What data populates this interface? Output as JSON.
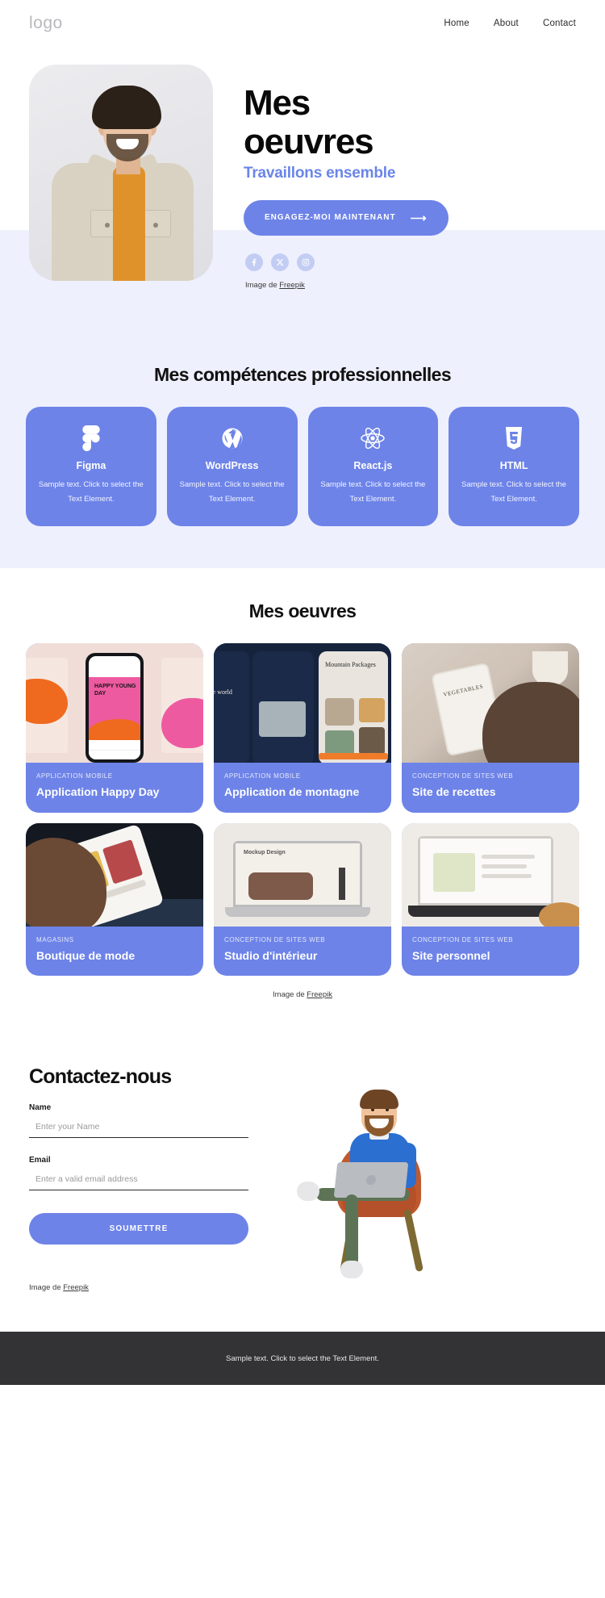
{
  "header": {
    "logo": "logo",
    "nav": [
      {
        "label": "Home"
      },
      {
        "label": "About"
      },
      {
        "label": "Contact"
      }
    ]
  },
  "hero": {
    "title_line1": "Mes",
    "title_line2": "oeuvres",
    "subtitle": "Travaillons ensemble",
    "cta_label": "ENGAGEZ-MOI MAINTENANT",
    "cta_arrow": "⟶",
    "socials": [
      {
        "name": "facebook-icon",
        "label": "Facebook"
      },
      {
        "name": "x-twitter-icon",
        "label": "X"
      },
      {
        "name": "instagram-icon",
        "label": "Instagram"
      }
    ],
    "credit_prefix": "Image de ",
    "credit_link": "Freepik",
    "photo_alt": "Homme souriant avec lunettes roses et veste beige"
  },
  "skills": {
    "title": "Mes compétences professionnelles",
    "cards": [
      {
        "icon": "figma-icon",
        "name": "Figma",
        "desc": "Sample text. Click to select the Text Element."
      },
      {
        "icon": "wordpress-icon",
        "name": "WordPress",
        "desc": "Sample text. Click to select the Text Element."
      },
      {
        "icon": "react-icon",
        "name": "React.js",
        "desc": "Sample text. Click to select the Text Element."
      },
      {
        "icon": "html5-icon",
        "name": "HTML",
        "desc": "Sample text. Click to select the Text Element."
      }
    ]
  },
  "portfolio": {
    "title": "Mes oeuvres",
    "items": [
      {
        "category": "APPLICATION MOBILE",
        "name": "Application Happy Day",
        "thumb_alt": "Maquette application Happy Young Day"
      },
      {
        "category": "APPLICATION MOBILE",
        "name": "Application de montagne",
        "thumb_alt": "Maquette application Mountain Packages"
      },
      {
        "category": "CONCEPTION DE SITES WEB",
        "name": "Site de recettes",
        "thumb_alt": "Main tenant un téléphone avec une recette"
      },
      {
        "category": "MAGASINS",
        "name": "Boutique de mode",
        "thumb_alt": "Main tenant un téléphone boutique de mode"
      },
      {
        "category": "CONCEPTION DE SITES WEB",
        "name": "Studio d'intérieur",
        "thumb_alt": "Ordinateur portable avec maquette design"
      },
      {
        "category": "CONCEPTION DE SITES WEB",
        "name": "Site personnel",
        "thumb_alt": "Ordinateur portable avec site de recettes"
      }
    ],
    "credit_prefix": "Image de ",
    "credit_link": "Freepik",
    "thumb_texts": {
      "happy_title": "HAPPY YOUNG DAY",
      "mountain_explore": "ore\nworld",
      "mountain_title": "Mountain Packages",
      "recipe_label": "VEGETABLES",
      "studio_label": "Mockup Design"
    }
  },
  "contact": {
    "title": "Contactez-nous",
    "name_label": "Name",
    "name_placeholder": "Enter your Name",
    "name_value": "",
    "email_label": "Email",
    "email_placeholder": "Enter a valid email address",
    "email_value": "",
    "submit_label": "SOUMETTRE",
    "credit_prefix": "Image de ",
    "credit_link": "Freepik",
    "illustration_alt": "Illustration 3D d'un homme assis avec un ordinateur portable"
  },
  "footer": {
    "text": "Sample text. Click to select the Text Element."
  },
  "colors": {
    "accent": "#6d83e8",
    "accent_soft": "#c3cdf4",
    "band": "#eef0fd",
    "footer_bg": "#333335"
  }
}
